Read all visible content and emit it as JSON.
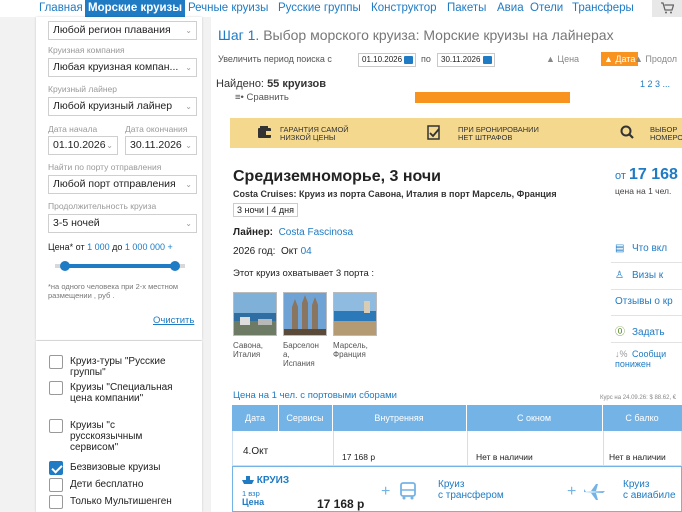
{
  "nav": {
    "items": [
      "Главная",
      "Морские круизы",
      "Речные круизы",
      "Русские группы",
      "Конструктор",
      "Пакеты",
      "Авиа",
      "Отели",
      "Трансферы"
    ],
    "active_index": 1
  },
  "filters": {
    "region": "Любой регион плавания",
    "company_label": "Круизная компания",
    "company": "Любая круизная компан...",
    "liner_label": "Круизный лайнер",
    "liner": "Любой круизный лайнер",
    "date_start_label": "Дата начала",
    "date_end_label": "Дата окончания",
    "date_start": "01.10.2026",
    "date_end": "30.11.2026",
    "port_label": "Найти по порту отправления",
    "port": "Любой порт отправления",
    "duration_label": "Продолжительность круиза",
    "duration": "3-5 ночей",
    "price_prefix": "Цена* от",
    "price_from": "1 000",
    "price_to_word": "до",
    "price_to": "1 000 000 +",
    "price_slider_from_pct": 0,
    "price_slider_to_pct": 100,
    "price_note": "*на одного человека при 2-х местном размещении , руб .",
    "clear": "Очистить"
  },
  "checkboxes": [
    {
      "label": "Круиз-туры \"Русские группы\"",
      "checked": false
    },
    {
      "label": "Круизы \"Специальная цена компании\"",
      "checked": false
    },
    {
      "label": "Круизы \"с русскоязычным сервисом\"",
      "checked": false
    },
    {
      "label": "Безвизовые круизы",
      "checked": true
    },
    {
      "label": "Дети бесплатно",
      "checked": false
    },
    {
      "label": "Только Мультишенген",
      "checked": false
    }
  ],
  "header": {
    "step": "Шаг 1.",
    "step_title": "Выбор морского круиза: Морские круизы на лайнерах",
    "period_prefix": "Увеличить период поиска с",
    "period_from": "01.10.2026",
    "period_mid": "по",
    "period_to": "30.11.2026",
    "sort_price": "▲ Цена",
    "sort_date": "▲ Дата",
    "sort_duration": "▲ Продол",
    "found_prefix": "Найдено:",
    "found_count": "55 круизов",
    "pages": "1  2  3  ...",
    "compare": "≡• Сравнить"
  },
  "banner": [
    {
      "text": "ГАРАНТИЯ САМОЙ\nНИЗКОЙ ЦЕНЫ",
      "icon": "wallet-icon"
    },
    {
      "text": "ПРИ БРОНИРОВАНИИ\nНЕТ ШТРАФОВ",
      "icon": "document-check-icon"
    },
    {
      "text": "ВЫБОР\nНОМЕРО",
      "icon": "magnifier-icon"
    }
  ],
  "cruise": {
    "title": "Средиземноморье, 3  ночи",
    "company": "Costa Cruises:",
    "route": "Круиз из порта Савона, Италия в порт Марсель, Франция",
    "nights": "3 ночи | 4 дня",
    "price_from": "от",
    "price": "17 168",
    "price_sub": "цена на 1 чел.",
    "liner_label": "Лайнер:",
    "liner": "Costa Fascinosa",
    "year_label": "2026 год:",
    "month": "Окт",
    "day": "04",
    "ports_count": "Этот круиз охватывает 3 порта :",
    "ports": [
      "Савона,\nИталия",
      "Барселон\nа,\nИспания",
      "Марсель,\nФранция"
    ]
  },
  "side_links": [
    {
      "label": "Что вкл",
      "icon": "list-icon"
    },
    {
      "label": "Визы к",
      "icon": "person-icon"
    },
    {
      "label": "Отзывы о кр",
      "icon": ""
    },
    {
      "label": "Задать",
      "icon": "question-icon"
    },
    {
      "label": "Сообщи\nпонижен",
      "icon": "percent-icon"
    }
  ],
  "table": {
    "title": "Цена на 1 чел. с портовыми сборами",
    "course": "Курс на 24.09.26: $ 88.62, €",
    "headers": [
      "Дата",
      "Сервисы",
      "Внутренняя",
      "С окном",
      "С балко"
    ],
    "row": {
      "date": "4.Окт",
      "inner": "17 168 р",
      "window": "Нет в наличии",
      "balcony": "Нет в наличии"
    }
  },
  "cta": {
    "cruise_label": "КРУИЗ",
    "guests": "1 взр",
    "price_label": "Цена",
    "price": "17 168 р",
    "transfer": "Круиз\nс трансфером",
    "avia": "Круиз\nс авиабиле"
  }
}
